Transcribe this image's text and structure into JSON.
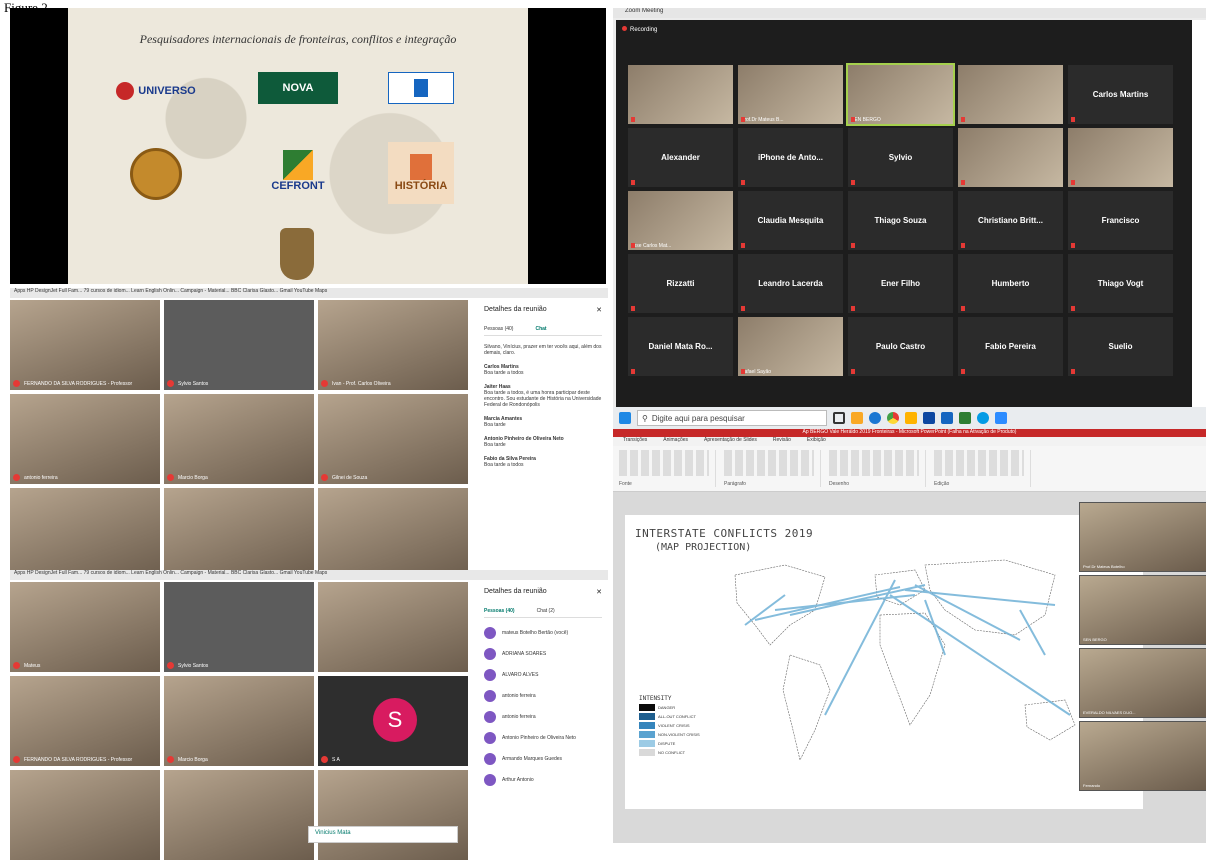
{
  "figure_label": "Figure 2",
  "slide": {
    "title": "Pesquisadores internacionais de fronteiras, conflitos e integração",
    "logos": [
      "UNIVERSO",
      "NOVA",
      "CEFRONT",
      "HISTÓRIA"
    ]
  },
  "zoom": {
    "window_title": "Zoom Meeting",
    "recording_label": "Recording",
    "participants": [
      {
        "name": "",
        "video": true
      },
      {
        "name": "Prof.Dr Mateus B...",
        "video": true
      },
      {
        "name": "SEN BERGO",
        "video": true,
        "active": true
      },
      {
        "name": "",
        "video": true
      },
      {
        "name": "Carlos Martins",
        "video": false
      },
      {
        "name": "Alexander",
        "video": false
      },
      {
        "name": "iPhone de Anto...",
        "video": false
      },
      {
        "name": "Sylvio",
        "video": false
      },
      {
        "name": "",
        "video": true
      },
      {
        "name": "",
        "video": true
      },
      {
        "name": "Jose Carlos Mat...",
        "video": true
      },
      {
        "name": "Claudia Mesquita",
        "video": false
      },
      {
        "name": "Thiago Souza",
        "video": false
      },
      {
        "name": "Christiano Britt...",
        "video": false
      },
      {
        "name": "Francisco",
        "video": false
      },
      {
        "name": "Rizzatti",
        "video": false
      },
      {
        "name": "Leandro Lacerda",
        "video": false
      },
      {
        "name": "Ener Filho",
        "video": false
      },
      {
        "name": "Humberto",
        "video": false
      },
      {
        "name": "Thiago Vogt",
        "video": false
      },
      {
        "name": "Daniel Mata Ro...",
        "video": false
      },
      {
        "name": "Rafael Sayão",
        "video": true
      },
      {
        "name": "Paulo Castro",
        "video": false
      },
      {
        "name": "Fabio Pereira",
        "video": false
      },
      {
        "name": "Suelio",
        "video": false
      }
    ]
  },
  "taskbar": {
    "search_placeholder": "Digite aqui para pesquisar"
  },
  "meet_top": {
    "browser_bar": "Apps   HP DesignJet Full Fam...   79 cursos de idiom...   Learn English Onlin...   Campaign - Material...   BBC Clarisa Glasto...   Gmail   YouTube   Maps",
    "details_title": "Detalhes da reunião",
    "tab_people": "Pessoas (40)",
    "tab_chat": "Chat",
    "tiles": [
      {
        "name": "FERNANDO DA SILVA RODRIGUES - Professor"
      },
      {
        "name": "Sylvio Santos"
      },
      {
        "name": "Ivan - Prof. Carlos Oliveira"
      },
      {
        "name": "antonio ferreira"
      },
      {
        "name": "Marcio Borga"
      },
      {
        "name": "Gilnei de Souza"
      },
      {
        "name": ""
      },
      {
        "name": ""
      },
      {
        "name": ""
      }
    ],
    "chat": [
      {
        "author": "",
        "text": "Silvano, Vinícius, prazer em ter vocês aqui, além dos demais, claro."
      },
      {
        "author": "Carlos Martins",
        "text": "Boa tarde a todos"
      },
      {
        "author": "Jaiter Haas",
        "text": "Boa tarde a todos, é uma honra participar deste encontro. Sou estudante de História na Universidade Federal de Rondonópolis"
      },
      {
        "author": "Marcia Amantes",
        "text": "Boa tarde"
      },
      {
        "author": "Antonio Pinheiro de Oliveira Neto",
        "text": "Boa tarde"
      },
      {
        "author": "Fabio da Silva Pereira",
        "text": "Boa tarde a todos"
      }
    ]
  },
  "meet_bottom": {
    "browser_bar": "Apps   HP DesignJet Full Fam...   79 cursos de idiom...   Learn English Onlin...   Campaign - Material...   BBC Clarisa Glasto...   Gmail   YouTube   Maps",
    "details_title": "Detalhes da reunião",
    "tab_people": "Pessoas (40)",
    "tab_chat": "Chat (2)",
    "avatar_letter": "S",
    "tiles": [
      {
        "name": "Mateus"
      },
      {
        "name": "Sylvio Santos"
      },
      {
        "name": ""
      },
      {
        "name": "FERNANDO DA SILVA RODRIGUES - Professor"
      },
      {
        "name": "Marcio Borga"
      },
      {
        "name": "S A"
      },
      {
        "name": ""
      },
      {
        "name": ""
      },
      {
        "name": ""
      }
    ],
    "people": [
      "mateus Botelho Bertão (você)",
      "ADRIANA SOARES",
      "ALVARO ALVES",
      "antonio ferreira",
      "antonio ferreira",
      "Antonio Pinheiro de Oliveira Neto",
      "Armando Marques Guedes",
      "Arthur Antonio"
    ],
    "popup_name": "Vinicius Mata"
  },
  "ppt": {
    "window_title": "Ap BERGO Vale Heráldo 2019 Fronteiras - Microsoft PowerPoint (Falha na Ativação de Produto)",
    "menu": [
      "Transições",
      "Animações",
      "Apresentação de Slides",
      "Revisão",
      "Exibição"
    ],
    "ribbon_groups": [
      "Fonte",
      "Parágrafo",
      "Desenho",
      "Edição"
    ],
    "slide_title_1": "INTERSTATE CONFLICTS 2019",
    "slide_title_2": "(MAP PROJECTION)",
    "legend_title": "INTENSITY",
    "legend": [
      {
        "label": "DANGER",
        "color": "#0b0b0b"
      },
      {
        "label": "ALL-OUT CONFLICT",
        "color": "#1f5f8f"
      },
      {
        "label": "VIOLENT CRISIS",
        "color": "#3585bc"
      },
      {
        "label": "NON-VIOLENT CRISIS",
        "color": "#5ba3d0"
      },
      {
        "label": "DISPUTE",
        "color": "#9ccbe5"
      },
      {
        "label": "NO CONFLICT",
        "color": "#d9d9d9"
      }
    ],
    "video_strip": [
      "Prof.Dr Mateus Botelho",
      "SEN BERGO",
      "EVERALDO NILVAES DUO...",
      "Fernando"
    ]
  },
  "colors": {
    "zoom_stage": "#1d1d1d",
    "recording_dot": "#e53935",
    "ppt_titlebar": "#c62828",
    "meet_accent": "#00796b"
  }
}
